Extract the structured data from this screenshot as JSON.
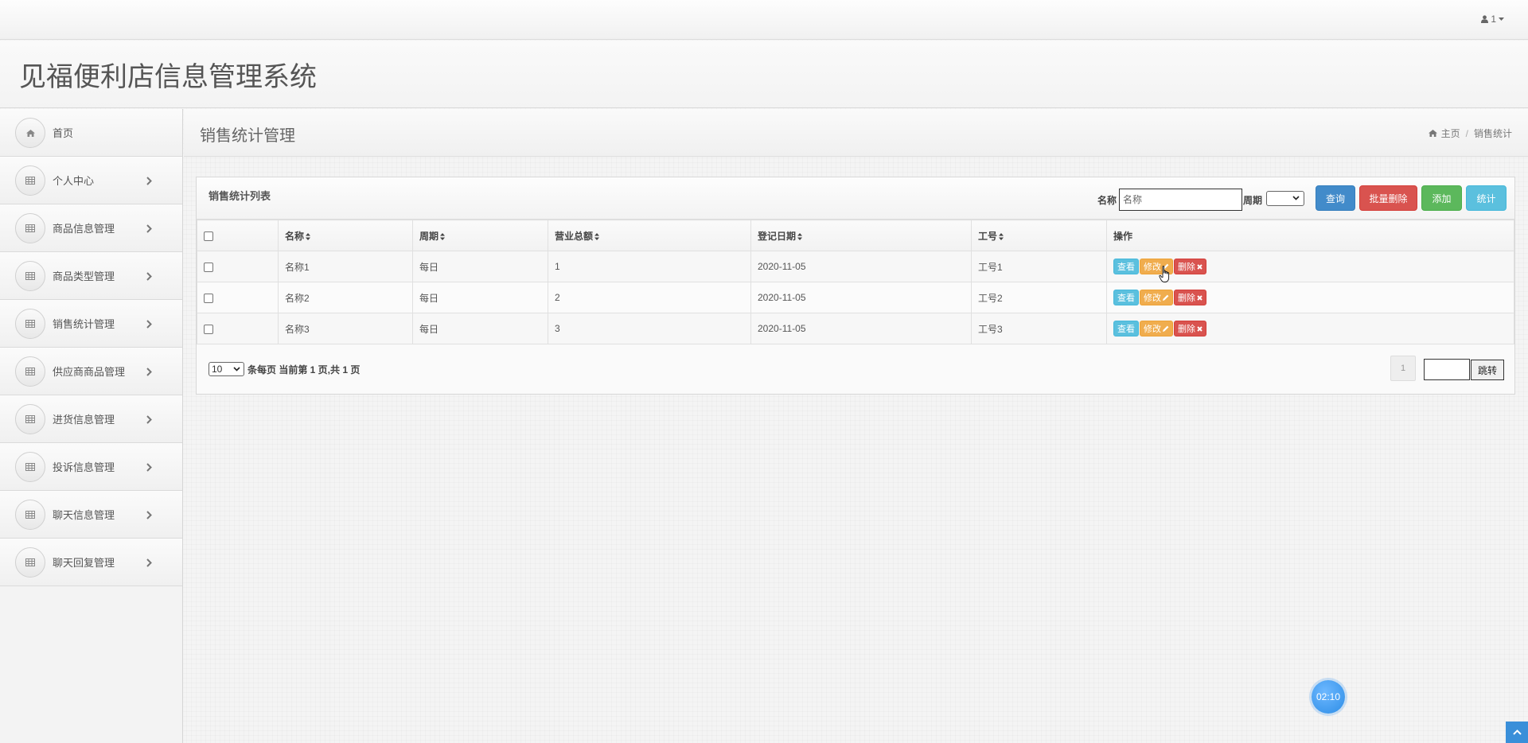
{
  "header": {
    "user_label": "1",
    "app_title": "见福便利店信息管理系统"
  },
  "sidebar": {
    "items": [
      {
        "label": "首页",
        "icon": "home-icon"
      },
      {
        "label": "个人中心",
        "icon": "table-icon"
      },
      {
        "label": "商品信息管理",
        "icon": "table-icon"
      },
      {
        "label": "商品类型管理",
        "icon": "table-icon"
      },
      {
        "label": "销售统计管理",
        "icon": "table-icon"
      },
      {
        "label": "供应商商品管理",
        "icon": "table-icon"
      },
      {
        "label": "进货信息管理",
        "icon": "table-icon"
      },
      {
        "label": "投诉信息管理",
        "icon": "table-icon"
      },
      {
        "label": "聊天信息管理",
        "icon": "table-icon"
      },
      {
        "label": "聊天回复管理",
        "icon": "table-icon"
      }
    ]
  },
  "content": {
    "title": "销售统计管理",
    "breadcrumb_home": "主页",
    "breadcrumb_current": "销售统计"
  },
  "panel": {
    "title": "销售统计列表",
    "search_label": "名称",
    "search_placeholder": "名称",
    "period_label": "周期",
    "query_button": "查询",
    "batch_delete_button": "批量删除",
    "add_button": "添加",
    "stat_button": "统计"
  },
  "table": {
    "headers": [
      "名称",
      "周期",
      "营业总额",
      "登记日期",
      "工号",
      "操作"
    ],
    "rows": [
      {
        "name": "名称1",
        "period": "每日",
        "total": "1",
        "date": "2020-11-05",
        "staff_id": "工号1"
      },
      {
        "name": "名称2",
        "period": "每日",
        "total": "2",
        "date": "2020-11-05",
        "staff_id": "工号2"
      },
      {
        "name": "名称3",
        "period": "每日",
        "total": "3",
        "date": "2020-11-05",
        "staff_id": "工号3"
      }
    ],
    "view_label": "查看",
    "edit_label": "修改",
    "delete_label": "删除"
  },
  "pager": {
    "page_size": "10",
    "info_text": "条每页 当前第 1 页,共 1 页",
    "current_page": "1",
    "jump_label": "跳转"
  },
  "timer": "02:10",
  "colors": {
    "primary": "#428bca",
    "danger": "#d9534f",
    "success": "#5cb85c",
    "info": "#5bc0de",
    "warning": "#f0ad4e"
  }
}
